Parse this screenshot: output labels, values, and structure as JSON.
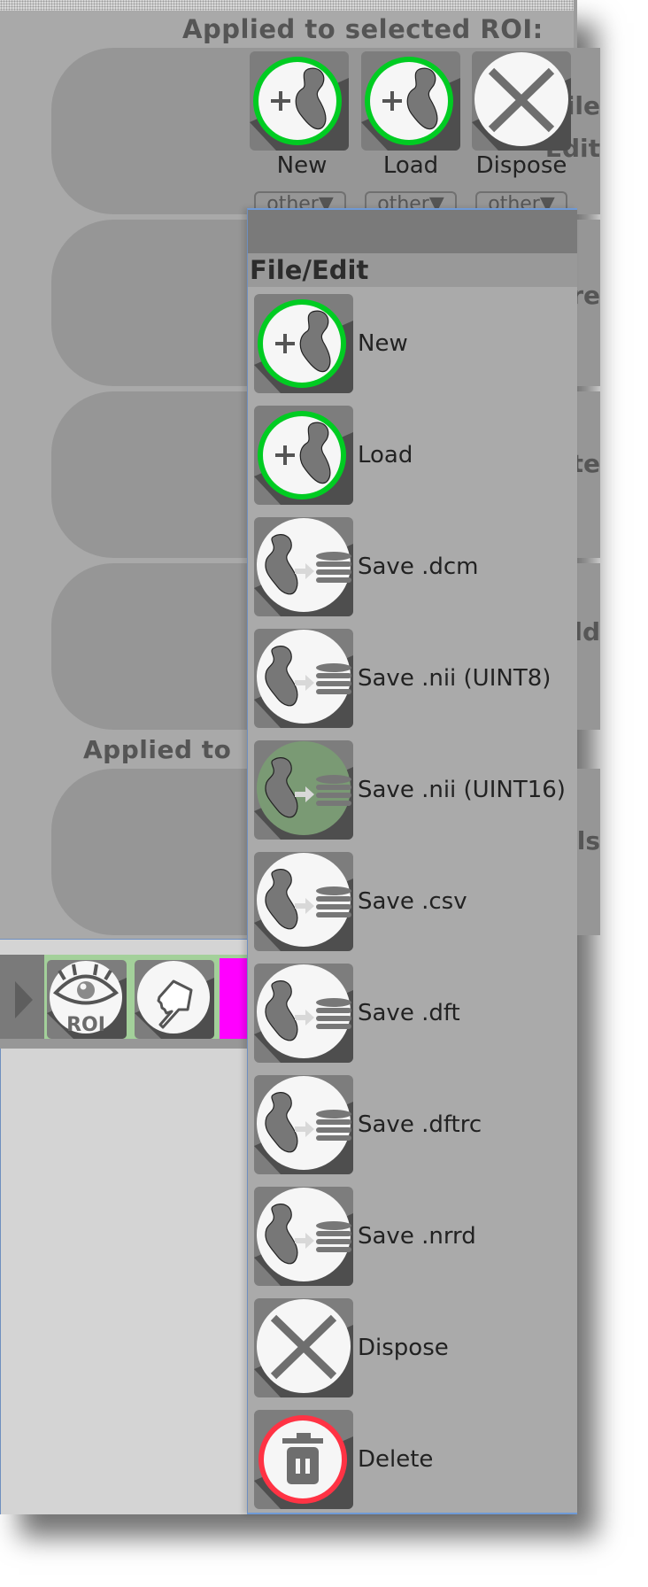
{
  "heading_selected": "Applied to selected ROI:",
  "heading_all_partial": "Applied to",
  "groups": [
    {
      "label_line1": "File",
      "label_line2": "Edit"
    },
    {
      "label": "Measure"
    },
    {
      "label": "Create"
    },
    {
      "label": "Threshold"
    },
    {
      "label": "Tools"
    }
  ],
  "top_buttons": [
    {
      "label": "New",
      "icon": "new-roi-icon",
      "dropdown": "other▼"
    },
    {
      "label": "Load",
      "icon": "load-roi-icon",
      "dropdown": "other▼"
    },
    {
      "label": "Dispose",
      "icon": "dispose-icon",
      "dropdown": "other▼"
    }
  ],
  "popup": {
    "section_title": "File/Edit",
    "items": [
      {
        "label": "New",
        "icon": "new-roi-icon"
      },
      {
        "label": "Load",
        "icon": "load-roi-icon"
      },
      {
        "label": "Save .dcm",
        "icon": "save-roi-icon"
      },
      {
        "label": "Save .nii (UINT8)",
        "icon": "save-roi-icon"
      },
      {
        "label": "Save .nii (UINT16)",
        "icon": "save-roi-icon",
        "hovered": true
      },
      {
        "label": "Save .csv",
        "icon": "save-roi-icon"
      },
      {
        "label": "Save .dft",
        "icon": "save-roi-icon"
      },
      {
        "label": "Save .dftrc",
        "icon": "save-roi-icon"
      },
      {
        "label": "Save .nrrd",
        "icon": "save-roi-icon"
      },
      {
        "label": "Dispose",
        "icon": "dispose-icon"
      },
      {
        "label": "Delete",
        "icon": "delete-icon"
      }
    ]
  },
  "toolbar": {
    "roi_button_text": "ROI",
    "accent_color": "#ff00ff"
  },
  "colors": {
    "ring_green": "#00cc22",
    "ring_red": "#ff3344",
    "hover_green": "#7a9a74"
  }
}
